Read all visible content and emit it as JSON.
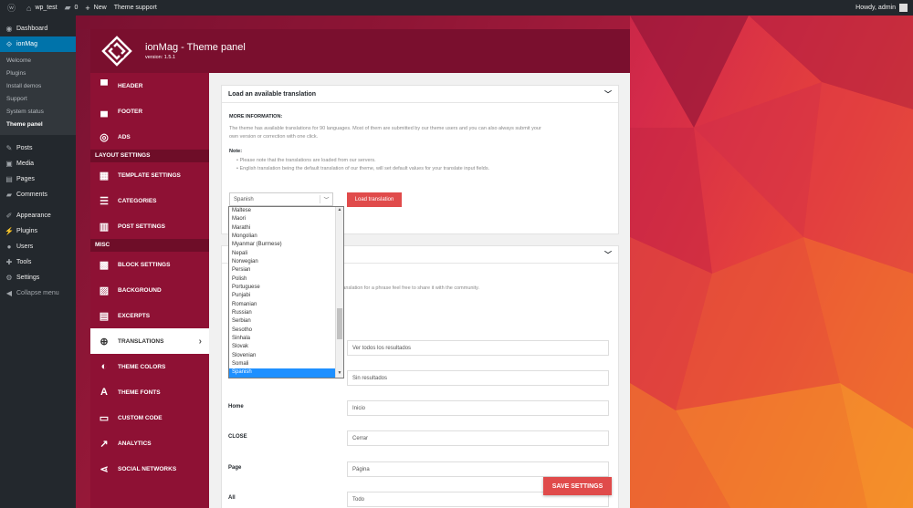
{
  "adminbar": {
    "site": "wp_test",
    "comments": "0",
    "new": "New",
    "support": "Theme support",
    "howdy": "Howdy, admin"
  },
  "wp_menu": {
    "dashboard": "Dashboard",
    "ionmag": "ionMag",
    "sub": [
      "Welcome",
      "Plugins",
      "Install demos",
      "Support",
      "System status",
      "Theme panel"
    ],
    "posts": "Posts",
    "media": "Media",
    "pages": "Pages",
    "comments": "Comments",
    "appearance": "Appearance",
    "plugins": "Plugins",
    "users": "Users",
    "tools": "Tools",
    "settings": "Settings",
    "collapse": "Collapse menu"
  },
  "panel": {
    "title": "ionMag - Theme panel",
    "version": "version: 1.5.1"
  },
  "menu": {
    "header": "HEADER",
    "footer": "FOOTER",
    "ads": "ADS",
    "layout_section": "LAYOUT SETTINGS",
    "template": "TEMPLATE SETTINGS",
    "categories": "CATEGORIES",
    "post": "POST SETTINGS",
    "misc_section": "MISC",
    "block": "BLOCK SETTINGS",
    "background": "BACKGROUND",
    "excerpts": "EXCERPTS",
    "translations": "TRANSLATIONS",
    "colors": "THEME COLORS",
    "fonts": "THEME FONTS",
    "custom_code": "CUSTOM CODE",
    "analytics": "ANALYTICS",
    "social": "SOCIAL NETWORKS"
  },
  "translation_box": {
    "title": "Load an available translation",
    "more_info": "MORE INFORMATION:",
    "desc_line1": "The theme has available translations for 90 languages. Most of them are submitted by our theme users and you can also always submit your",
    "desc_line2": "own version or correction with one click.",
    "note": "Note:",
    "bullet1": "Please note that the translations are loaded from our servers.",
    "bullet2": "English translation being the default translation of our theme, will set default values for your translate input fields.",
    "selected_language": "Spanish",
    "load_button": "Load translation"
  },
  "dropdown_options": [
    "Maltese",
    "Maori",
    "Marathi",
    "Mongolian",
    "Myanmar (Burmese)",
    "Nepali",
    "Norwegian",
    "Persian",
    "Polish",
    "Portuguese",
    "Punjabi",
    "Romanian",
    "Russian",
    "Serbian",
    "Sesotho",
    "Sinhala",
    "Slovak",
    "Slovenian",
    "Somali",
    "Spanish"
  ],
  "custom_box": {
    "share_text": "translation for a phrase feel free to share it with the community."
  },
  "fields": [
    {
      "label": "",
      "value": "Ver todos los resultados"
    },
    {
      "label": "",
      "value": "Sin resultados"
    },
    {
      "label": "Home",
      "value": "Inicio"
    },
    {
      "label": "CLOSE",
      "value": "Cerrar"
    },
    {
      "label": "Page",
      "value": "Página"
    },
    {
      "label": "All",
      "value": "Todo"
    }
  ],
  "save_button": "SAVE SETTINGS",
  "colors": {
    "accent": "#e04b4b",
    "panel_menu": "#8e1134",
    "panel_header": "#7a0f2e",
    "wp_blue": "#0073aa"
  }
}
